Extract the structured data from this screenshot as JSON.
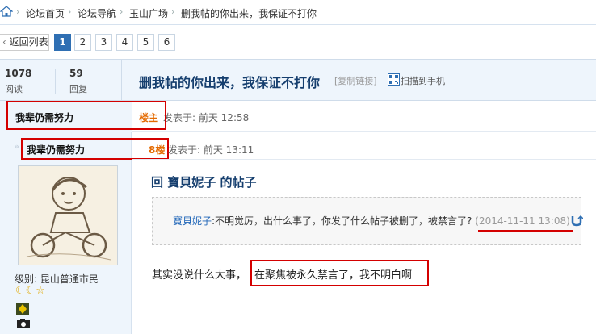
{
  "breadcrumb": {
    "items": [
      "论坛首页",
      "论坛导航",
      "玉山广场",
      "删我帖的你出来，我保证不打你"
    ],
    "separator": "›"
  },
  "pager": {
    "back_label": "返回列表",
    "pages": [
      "1",
      "2",
      "3",
      "4",
      "5",
      "6"
    ],
    "current_page": "1"
  },
  "thread": {
    "views": "1078",
    "views_label": "阅读",
    "replies": "59",
    "replies_label": "回复",
    "title": "删我帖的你出来，我保证不打你",
    "copy_link": "[复制链接]",
    "scan_label": "扫描到手机"
  },
  "posts": [
    {
      "author": "我辈仍需努力",
      "floor": "楼主",
      "posted": "发表于: 前天 12:58"
    },
    {
      "author": "我辈仍需努力",
      "floor": "8楼",
      "posted": "发表于: 前天 13:11",
      "level": "级别: 昆山普通市民",
      "reply_title": "回 寶貝妮子 的帖子",
      "quote_user": "寶貝妮子",
      "quote_text": ":不明觉厉，出什么事了，你发了什么帖子被删了，被禁言了?",
      "quote_time": "(2014-11-11 13:08)",
      "body_prefix": "其实没说什么大事，",
      "body_highlight": "在聚焦被永久禁言了，我不明白啊"
    }
  ],
  "colors": {
    "accent": "#2f6fb3",
    "title": "#153e6e",
    "highlight_box": "#d40000",
    "floor": "#e46a00"
  }
}
